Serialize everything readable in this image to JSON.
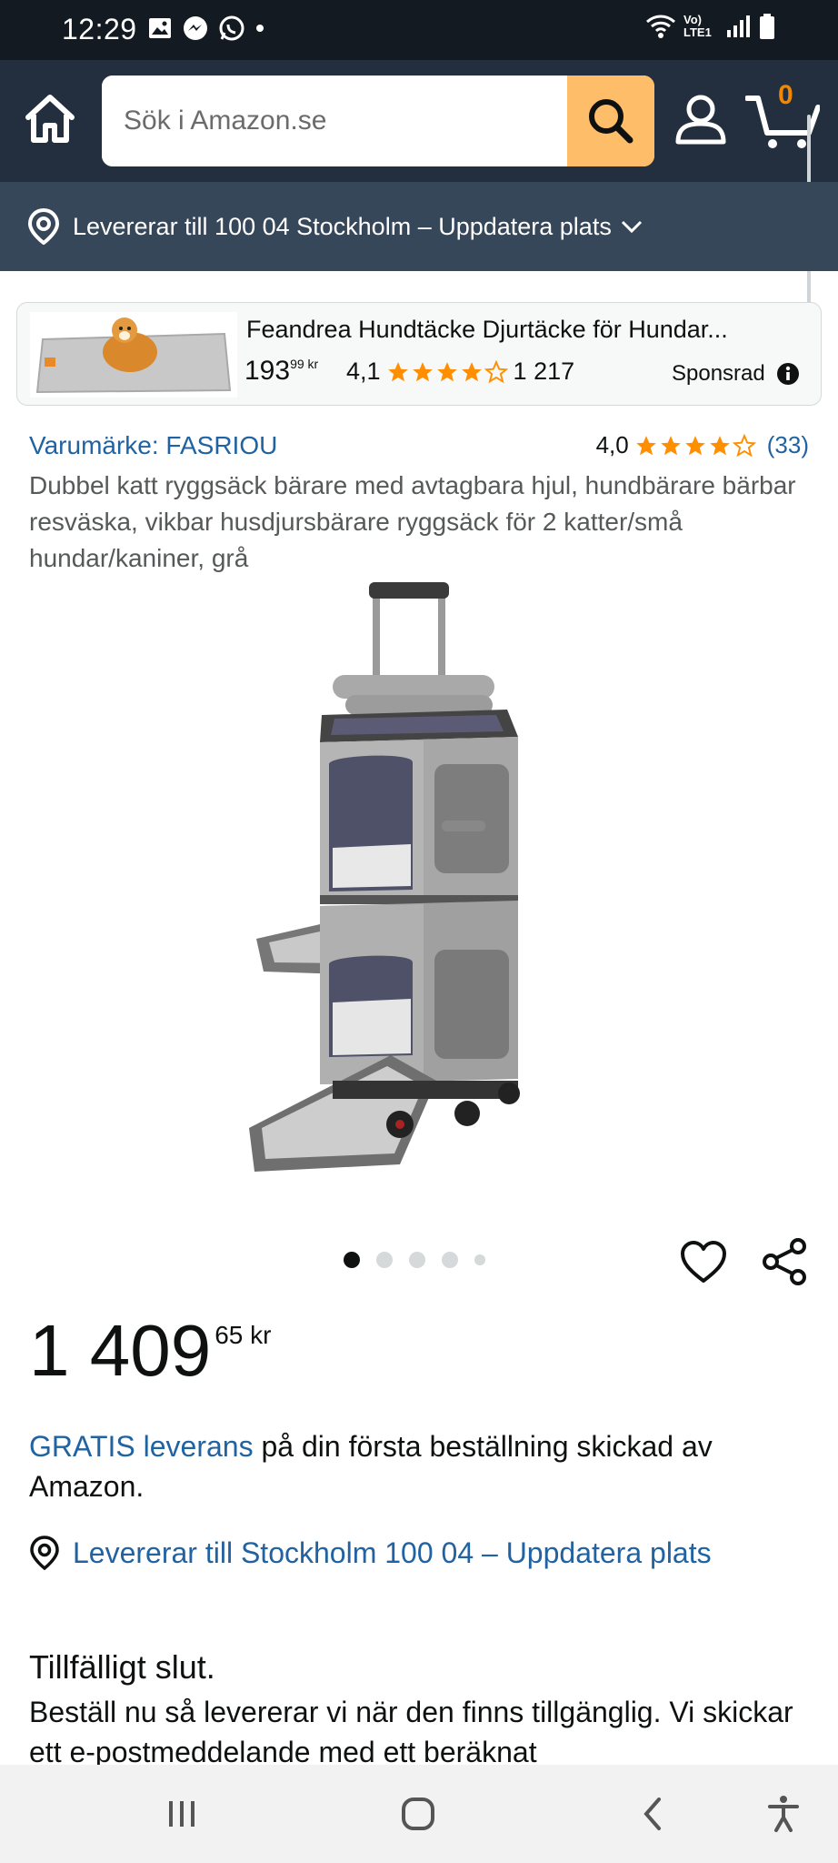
{
  "status_bar": {
    "time": "12:29",
    "network": "Vo) LTE1"
  },
  "header": {
    "search_placeholder": "Sök i Amazon.se",
    "cart_count": "0"
  },
  "location_bar": {
    "text": "Levererar till 100 04 Stockholm – Uppdatera plats"
  },
  "sponsored": {
    "title": "Feandrea Hundtäcke Djurtäcke för Hundar...",
    "price_whole": "193",
    "price_fraction": "99 kr",
    "rating": "4,1",
    "rating_count": "1 217",
    "label": "Sponsrad"
  },
  "product": {
    "brand": "Varumärke: FASRIOU",
    "rating": "4,0",
    "rating_count": "(33)",
    "title": "Dubbel katt ryggsäck bärare med avtagbara hjul, hundbärare bärbar resväska, vikbar husdjursbärare ryggsäck för 2 katter/små hundar/kaniner, grå",
    "price_whole": "1 409",
    "price_fraction": "65 kr",
    "free_delivery": "GRATIS leverans",
    "delivery_rest": " på din första beställning skickad av Amazon.",
    "deliver_to": "Levererar till Stockholm 100 04 – Uppdatera plats",
    "stock_title": "Tillfälligt slut.",
    "stock_desc": "Beställ nu så levererar vi när den finns tillgänglig. Vi skickar ett e-postmeddelande med ett beräknat"
  },
  "colors": {
    "header": "#232f3e",
    "location_bar": "#37475a",
    "search_button": "#febd69",
    "link": "#2162a1",
    "star": "#ff8f00",
    "cart_count": "#f08804"
  }
}
